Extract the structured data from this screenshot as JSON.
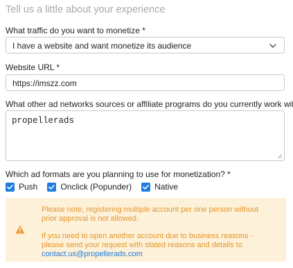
{
  "form": {
    "heading": "Tell us a little about your experience",
    "traffic": {
      "label": "What traffic do you want to monetize *",
      "value": "I have a website and want monetize its audience"
    },
    "website": {
      "label": "Website URL *",
      "value": "https://imszz.com"
    },
    "networks": {
      "label": "What other ad networks sources or affiliate programs do you currently work with *",
      "value": "propellerads"
    },
    "formats": {
      "label": "Which ad formats are you planning to use for monetization? *",
      "options": [
        {
          "label": "Push",
          "checked": true
        },
        {
          "label": "Onclick (Popunder)",
          "checked": true
        },
        {
          "label": "Native",
          "checked": true
        }
      ]
    }
  },
  "notice": {
    "line1": "Please note, registering multiple account per one person without prior approval is not allowed.",
    "line2": "If you need to open another account due to business reasons - please send your request with stated reasons and details to",
    "email": "contact.us@propellerads.com",
    "icon": "warning-icon",
    "color": "#e6962a",
    "background": "#fdf1d9"
  },
  "colors": {
    "accent": "#1f7be0"
  }
}
